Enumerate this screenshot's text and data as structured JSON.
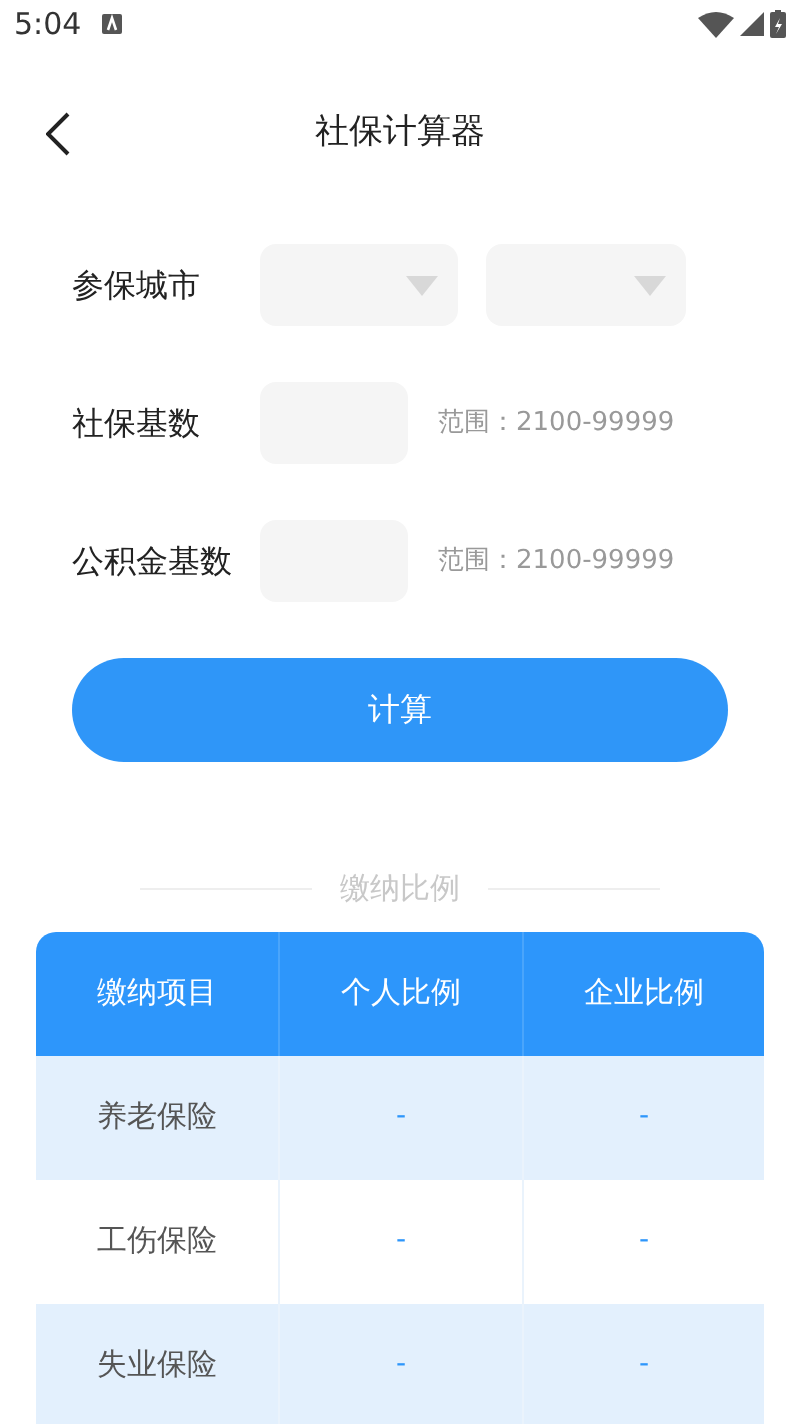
{
  "status_bar": {
    "time": "5:04"
  },
  "header": {
    "title": "社保计算器"
  },
  "form": {
    "city": {
      "label": "参保城市"
    },
    "social_base": {
      "label": "社保基数",
      "hint": "范围：2100-99999"
    },
    "fund_base": {
      "label": "公积金基数",
      "hint": "范围：2100-99999"
    },
    "submit": "计算"
  },
  "section_title": "缴纳比例",
  "table": {
    "columns": [
      "缴纳项目",
      "个人比例",
      "企业比例"
    ],
    "rows": [
      [
        "养老保险",
        "-",
        "-"
      ],
      [
        "工伤保险",
        "-",
        "-"
      ],
      [
        "失业保险",
        "-",
        "-"
      ]
    ]
  }
}
